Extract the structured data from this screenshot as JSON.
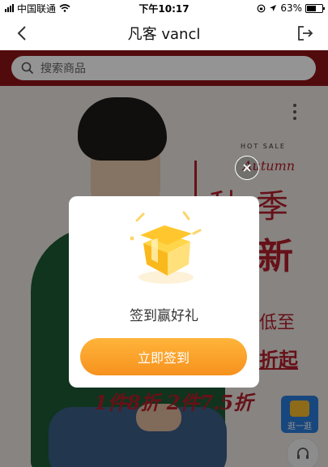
{
  "status_bar": {
    "carrier": "中国联通",
    "time": "下午10:17",
    "battery": "63%"
  },
  "nav": {
    "title": "凡客 vancl",
    "icons": {
      "back": "chevron-left-icon",
      "exit": "exit-icon"
    }
  },
  "search": {
    "placeholder": "搜索商品",
    "icon": "search-icon"
  },
  "banner": {
    "hot_sale": "HOT SALE",
    "autumn": "Autumn",
    "char_qiu": "秋",
    "char_ji": "季",
    "char_xin": "新",
    "char_di": "低至",
    "char_zheqi": "折起",
    "deal": "1件8折 2件7.5折"
  },
  "floating": {
    "badge_label": "逛一逛"
  },
  "modal": {
    "title": "签到赢好礼",
    "button_label": "立即签到",
    "gift_icon": "gift-box-icon",
    "close_icon": "close-icon"
  },
  "colors": {
    "accent_orange": "#f6921e",
    "banner_red": "#8d1417",
    "promo_red": "#b01e2a"
  }
}
